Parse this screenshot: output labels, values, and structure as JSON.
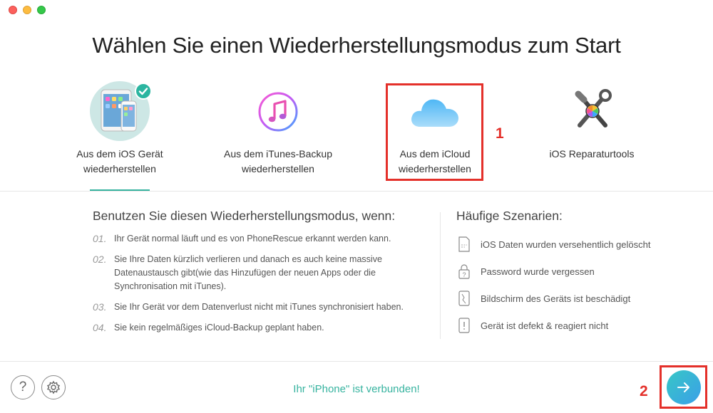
{
  "window": {
    "title": "Wählen Sie einen Wiederherstellungsmodus zum Start"
  },
  "modes": [
    {
      "icon": "ios-devices-icon",
      "line1": "Aus dem iOS Gerät",
      "line2": "wiederherstellen",
      "selected": true
    },
    {
      "icon": "itunes-icon",
      "line1": "Aus dem iTunes-Backup",
      "line2": "wiederherstellen",
      "selected": false
    },
    {
      "icon": "icloud-icon",
      "line1": "Aus dem iCloud",
      "line2": "wiederherstellen",
      "selected": false
    },
    {
      "icon": "repair-tools-icon",
      "line1": "iOS Reparaturtools",
      "line2": "",
      "selected": false
    }
  ],
  "annotations": {
    "step1": "1",
    "step2": "2"
  },
  "usage": {
    "title": "Benutzen Sie diesen Wiederherstellungsmodus, wenn:",
    "items": [
      {
        "num": "01.",
        "text": "Ihr Gerät normal läuft und es von PhoneRescue erkannt werden kann."
      },
      {
        "num": "02.",
        "text": "Sie Ihre Daten kürzlich verlieren und danach es auch keine massive Datenaustausch gibt(wie das Hinzufügen der neuen Apps oder die Synchronisation mit iTunes)."
      },
      {
        "num": "03.",
        "text": "Sie Ihr Gerät vor dem Datenverlust nicht mit iTunes synchronisiert haben."
      },
      {
        "num": "04.",
        "text": "Sie kein regelmäßiges iCloud-Backup geplant haben."
      }
    ]
  },
  "scenarios": {
    "title": "Häufige Szenarien:",
    "items": [
      {
        "icon": "deleted-file-icon",
        "text": "iOS Daten wurden versehentlich gelöscht"
      },
      {
        "icon": "password-icon",
        "text": "Password wurde vergessen"
      },
      {
        "icon": "broken-screen-icon",
        "text": "Bildschirm des Geräts ist beschädigt"
      },
      {
        "icon": "device-error-icon",
        "text": "Gerät ist defekt & reagiert nicht"
      }
    ]
  },
  "footer": {
    "help_glyph": "?",
    "status": "Ihr \"iPhone\" ist verbunden!"
  },
  "colors": {
    "accent": "#36b39f",
    "annotation": "#e4302a",
    "next_gradient_start": "#38c7c6",
    "next_gradient_end": "#3a9fe8"
  }
}
